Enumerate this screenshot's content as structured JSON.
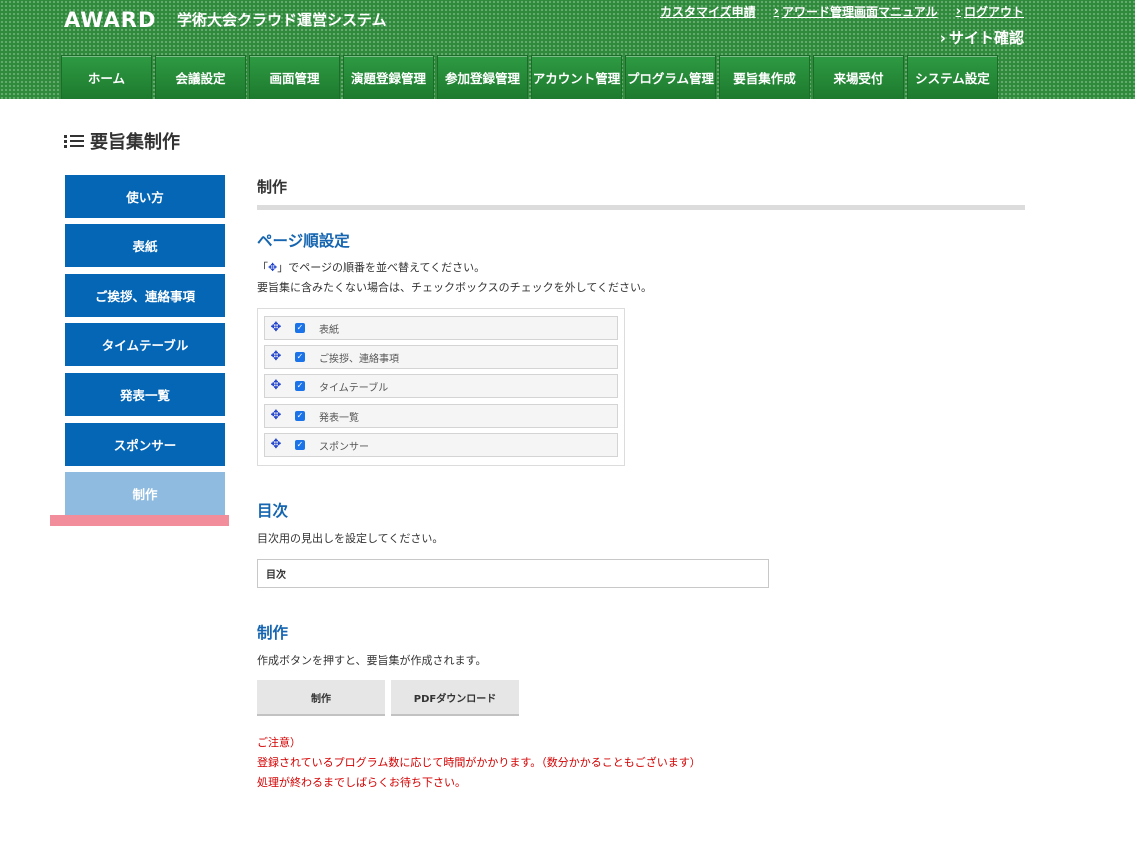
{
  "header": {
    "logo": "AWARD",
    "system_name": "学術大会クラウド運営システム",
    "links": [
      {
        "label": "カスタマイズ申請",
        "chevron": false
      },
      {
        "label": "アワード管理画面マニュアル",
        "chevron": true
      },
      {
        "label": "ログアウト",
        "chevron": true
      }
    ],
    "site_check": "サイト確認",
    "chevron_glyph": "›"
  },
  "nav": {
    "tabs": [
      "ホーム",
      "会議設定",
      "画面管理",
      "演題登録管理",
      "参加登録管理",
      "アカウント管理",
      "プログラム管理",
      "要旨集作成",
      "来場受付",
      "システム設定"
    ]
  },
  "page": {
    "title": "要旨集制作",
    "icon": "list-icon"
  },
  "sidebar": {
    "items": [
      {
        "label": "使い方",
        "active": false
      },
      {
        "label": "表紙",
        "active": false
      },
      {
        "label": "ご挨拶、連絡事項",
        "active": false
      },
      {
        "label": "タイムテーブル",
        "active": false
      },
      {
        "label": "発表一覧",
        "active": false
      },
      {
        "label": "スポンサー",
        "active": false
      },
      {
        "label": "制作",
        "active": true
      }
    ]
  },
  "main": {
    "heading": "制作",
    "page_order": {
      "heading": "ページ順設定",
      "desc1_before": "「",
      "desc1_icon": "✥",
      "desc1_after": "」でページの順番を並べ替えてください。",
      "desc2": "要旨集に含みたくない場合は、チェックボックスのチェックを外してください。",
      "move_icon": "✥",
      "check_glyph": "✓",
      "items": [
        {
          "label": "表紙",
          "checked": true
        },
        {
          "label": "ご挨拶、連絡事項",
          "checked": true
        },
        {
          "label": "タイムテーブル",
          "checked": true
        },
        {
          "label": "発表一覧",
          "checked": true
        },
        {
          "label": "スポンサー",
          "checked": true
        }
      ]
    },
    "toc": {
      "heading": "目次",
      "desc": "目次用の見出しを設定してください。",
      "value": "目次"
    },
    "production": {
      "heading": "制作",
      "desc": "作成ボタンを押すと、要旨集が作成されます。",
      "create_label": "制作",
      "pdf_label": "PDFダウンロード"
    },
    "notes": [
      "ご注意）",
      "登録されているプログラム数に応じて時間がかかります。（数分かかることもございます）",
      "処理が終わるまでしばらくお待ち下さい。"
    ]
  },
  "colors": {
    "header_green": "#2f8a3c",
    "accent_blue": "#0566b6",
    "active_blue": "#8fbbe0",
    "section_blue": "#1565b0",
    "note_red": "#d40000",
    "highlight_pink": "#f28e9c"
  }
}
